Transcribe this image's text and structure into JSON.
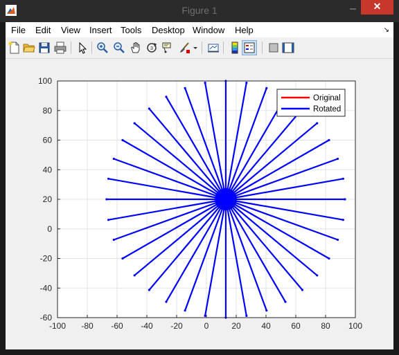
{
  "window": {
    "title": "Figure 1"
  },
  "menu": [
    "File",
    "Edit",
    "View",
    "Insert",
    "Tools",
    "Desktop",
    "Window",
    "Help"
  ],
  "toolbar_icons": [
    "new-figure-icon",
    "open-file-icon",
    "save-icon",
    "print-icon",
    "edit-plot-arrow-icon",
    "zoom-in-icon",
    "zoom-out-icon",
    "pan-hand-icon",
    "rotate-3d-icon",
    "data-cursor-icon",
    "brush-icon",
    "link-plot-icon",
    "colorbar-icon",
    "legend-icon",
    "hide-plot-tools-icon",
    "show-plot-tools-icon"
  ],
  "chart_data": {
    "type": "line",
    "title": "",
    "xlabel": "",
    "ylabel": "",
    "xlim": [
      -100,
      100
    ],
    "ylim": [
      -60,
      100
    ],
    "xticks": [
      -100,
      -80,
      -60,
      -40,
      -20,
      0,
      20,
      40,
      60,
      80,
      100
    ],
    "yticks": [
      -60,
      -40,
      -20,
      0,
      20,
      40,
      60,
      80,
      100
    ],
    "grid": true,
    "legend": {
      "placement": "top-right",
      "entries": [
        "Original",
        "Rotated"
      ]
    },
    "colors": {
      "Original": "#ff0000",
      "Rotated": "#0000ff"
    },
    "series": [
      {
        "name": "Original",
        "x": [
          13,
          13
        ],
        "y": [
          20,
          100
        ]
      },
      {
        "name": "Rotated",
        "center": [
          13,
          20
        ],
        "line_length": 80,
        "angles_deg": [
          0,
          10,
          20,
          30,
          40,
          50,
          60,
          70,
          80,
          90,
          100,
          110,
          120,
          130,
          140,
          150,
          160,
          170,
          180,
          190,
          200,
          210,
          220,
          230,
          240,
          250,
          260,
          270,
          280,
          290,
          300,
          310,
          320,
          330,
          340,
          350
        ]
      }
    ]
  }
}
